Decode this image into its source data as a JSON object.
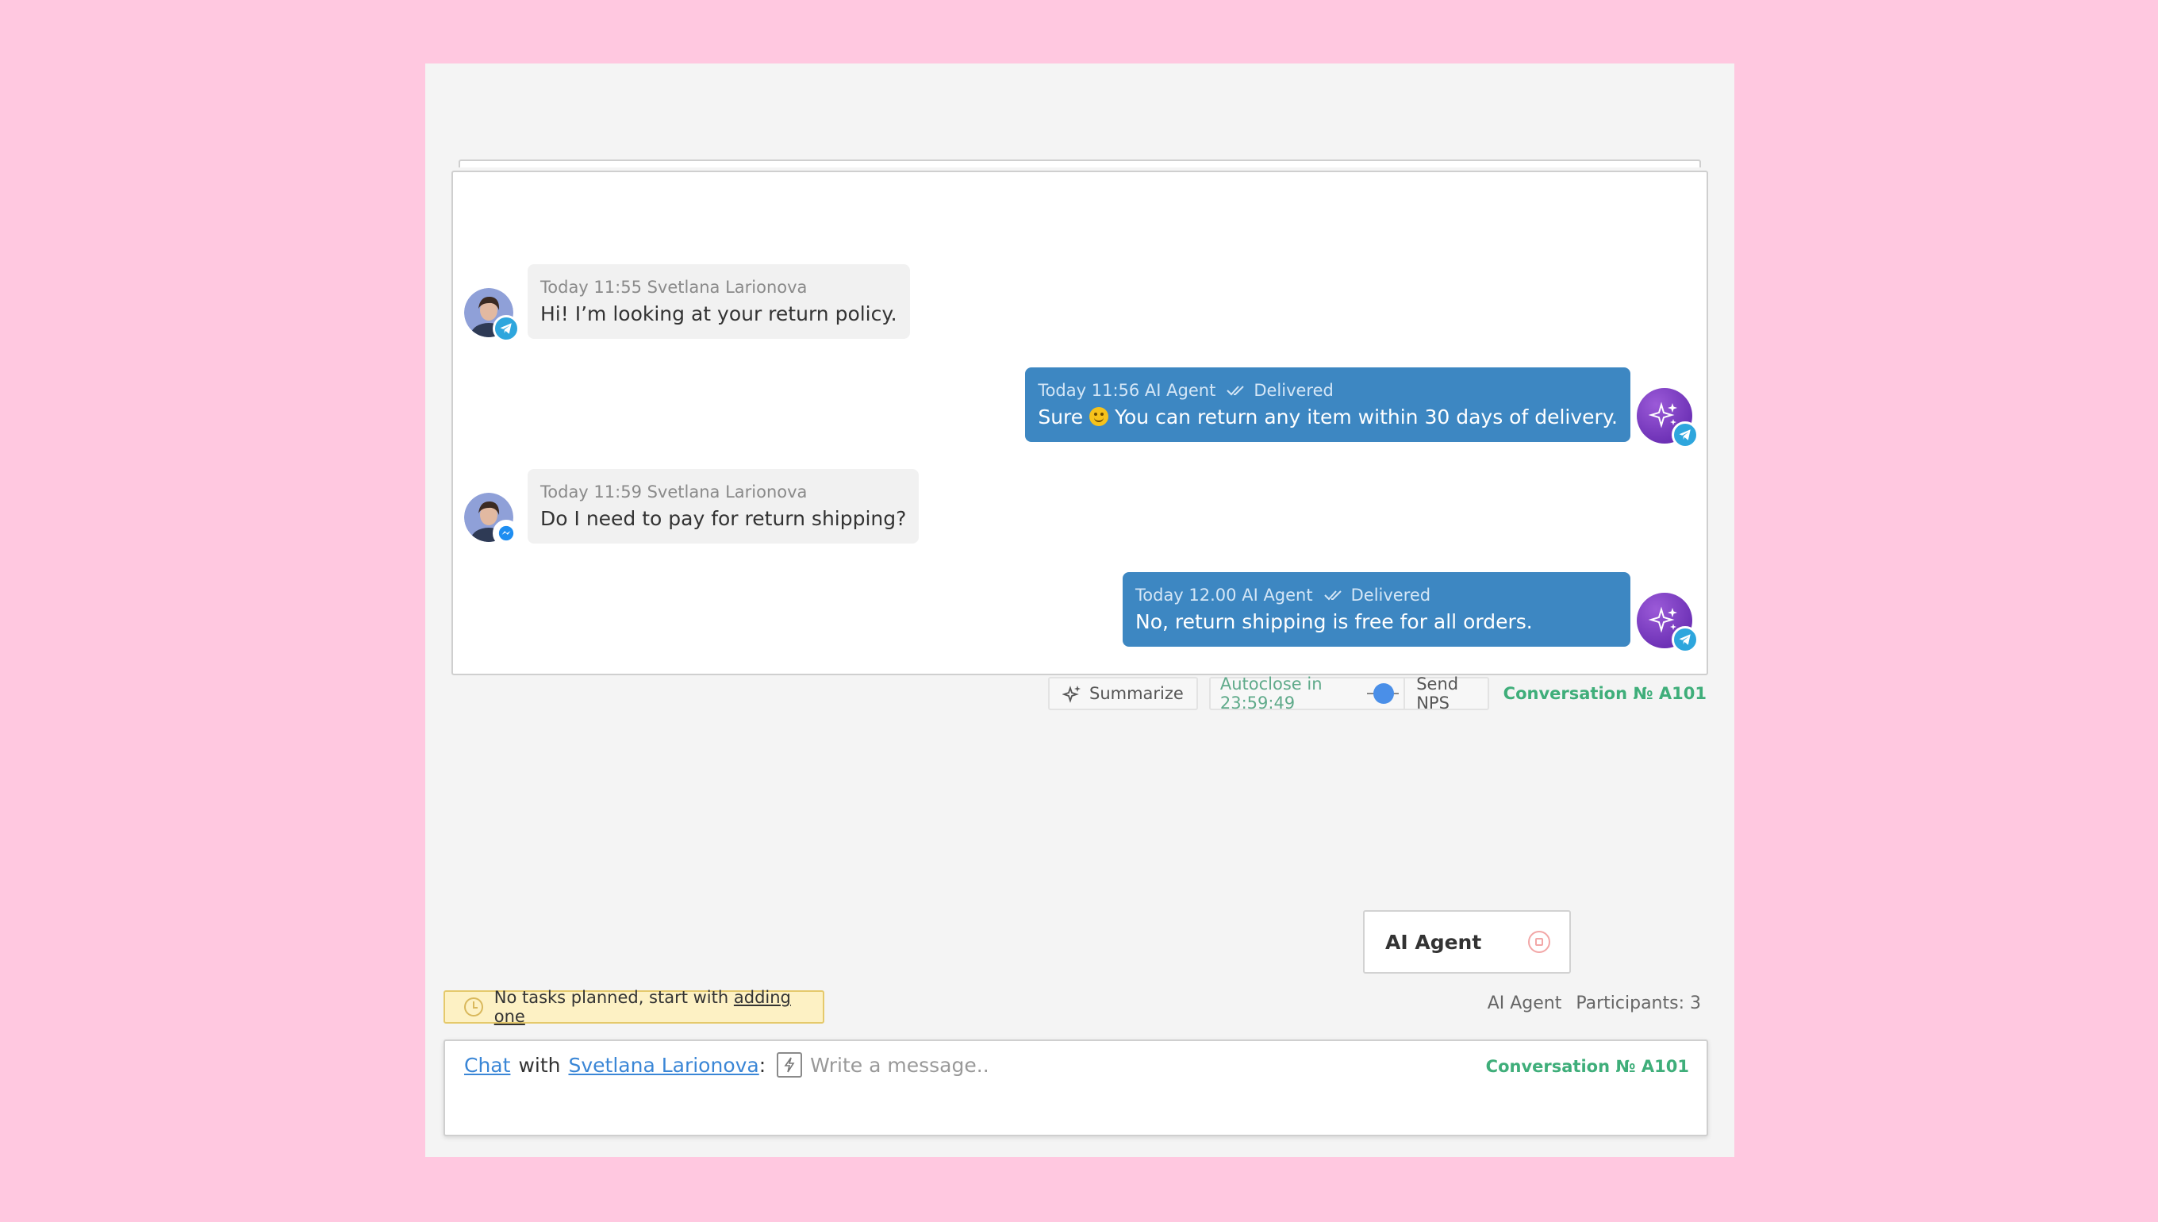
{
  "messages": [
    {
      "meta": "Today 11:55 Svetlana Larionova",
      "text": "Hi! I’m looking at your return policy."
    },
    {
      "meta": "Today 11:56 AI Agent",
      "status": "Delivered",
      "text_before": "Sure",
      "text_after": "You can return any item within 30 days of delivery."
    },
    {
      "meta": "Today 11:59 Svetlana Larionova",
      "text": "Do I need to pay for return shipping?"
    },
    {
      "meta": "Today 12.00 AI Agent",
      "status": "Delivered",
      "text": "No, return shipping is free for all orders."
    }
  ],
  "toolbar": {
    "summarize_label": "Summarize",
    "autoclose_label": "Autoclose in 23:59:49",
    "nps_label": "Send NPS",
    "conversation_label": "Conversation № A101"
  },
  "ai_card": {
    "label": "AI Agent"
  },
  "tasks": {
    "text": "No tasks planned, start with",
    "link": "adding one"
  },
  "participants": {
    "agent": "AI Agent",
    "count_label": "Participants: 3"
  },
  "composer": {
    "chat_link": "Chat",
    "with": "with",
    "contact_link": "Svetlana Larionova",
    "colon": ":",
    "placeholder": "Write a message..",
    "conversation_label": "Conversation № A101"
  },
  "colors": {
    "agent_bubble": "#3d87c2",
    "accent_green": "#3fae7a",
    "page_bg": "#ffc8e0"
  }
}
